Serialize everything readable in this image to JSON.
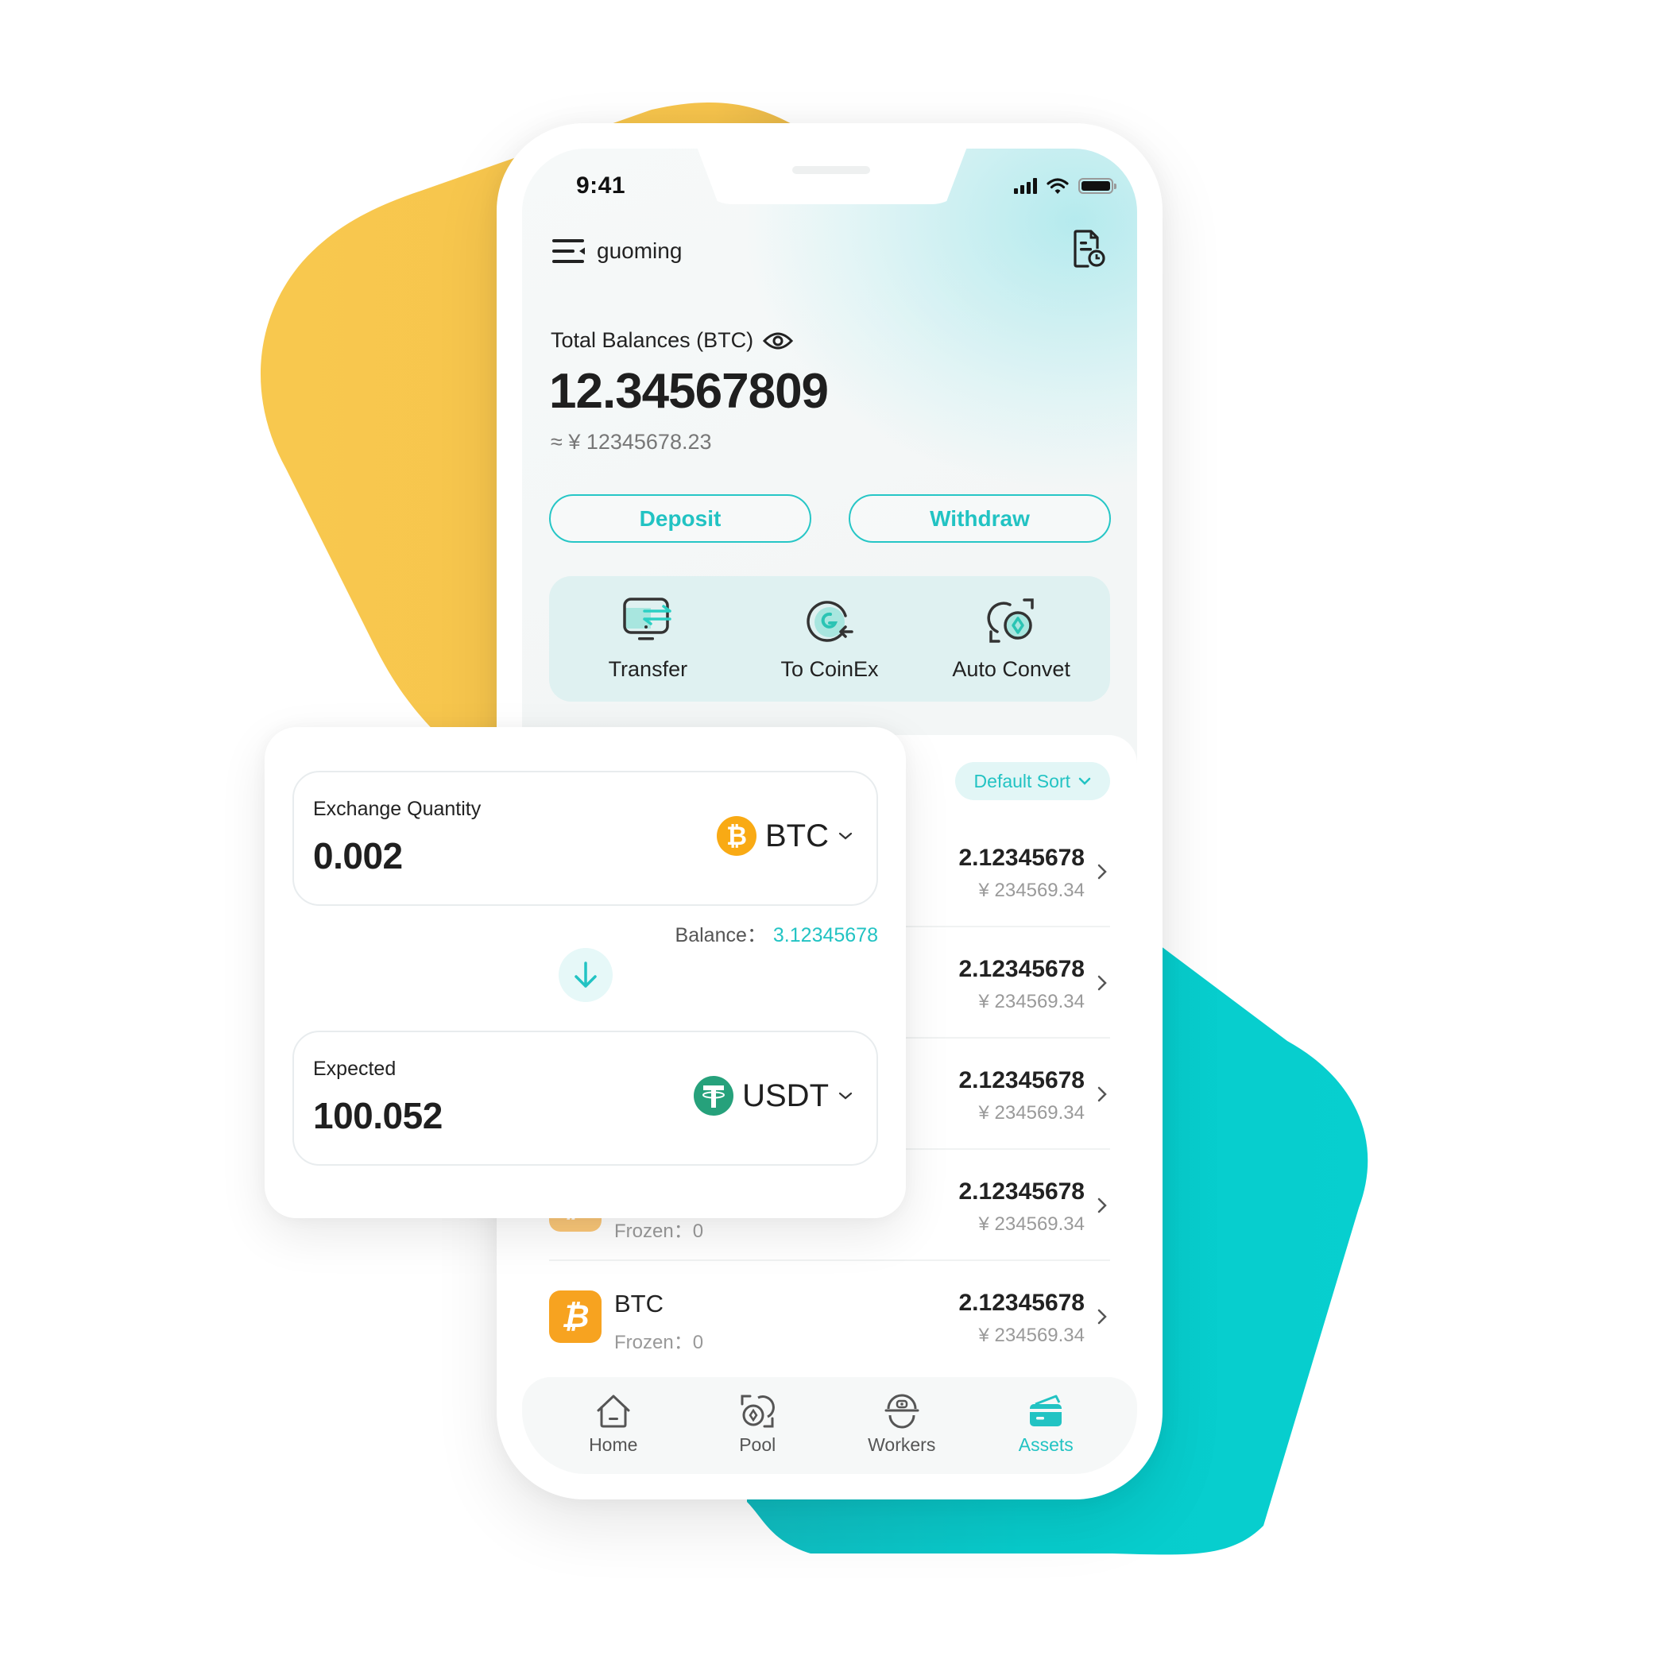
{
  "colors": {
    "accent": "#22c3c3",
    "yellow_shape": "#f7c54c",
    "teal_shape": "#07cccc",
    "btc_orange": "#f7a320",
    "usdt_green": "#26a17b"
  },
  "status_bar": {
    "time": "9:41",
    "icons": [
      "signal-icon",
      "wifi-icon",
      "battery-icon"
    ]
  },
  "header": {
    "menu_icon": "menu-icon",
    "username": "guoming",
    "record_icon": "record-icon"
  },
  "balance": {
    "label": "Total Balances (BTC)",
    "visibility_icon": "eye-icon",
    "value": "12.34567809",
    "fiat": "≈ ¥ 12345678.23"
  },
  "actions": {
    "deposit_label": "Deposit",
    "withdraw_label": "Withdraw"
  },
  "shortcuts": [
    {
      "label": "Transfer",
      "icon": "transfer-icon"
    },
    {
      "label": "To CoinEx",
      "icon": "coinex-icon"
    },
    {
      "label": "Auto Convet",
      "icon": "auto-convert-icon"
    }
  ],
  "asset_list": {
    "sort_label": "Default Sort",
    "rows": [
      {
        "name": "",
        "frozen": "",
        "amount": "2.12345678",
        "fiat": "¥ 234569.34"
      },
      {
        "name": "",
        "frozen": "",
        "amount": "2.12345678",
        "fiat": "¥ 234569.34"
      },
      {
        "name": "",
        "frozen": "",
        "amount": "2.12345678",
        "fiat": "¥ 234569.34"
      },
      {
        "name": "",
        "frozen": "Frozen：0",
        "amount": "2.12345678",
        "fiat": "¥ 234569.34"
      },
      {
        "name": "BTC",
        "frozen": "Frozen：0",
        "amount": "2.12345678",
        "fiat": "¥ 234569.34"
      }
    ]
  },
  "tabbar": {
    "tabs": [
      {
        "label": "Home",
        "icon": "home-icon",
        "active": false
      },
      {
        "label": "Pool",
        "icon": "pool-icon",
        "active": false
      },
      {
        "label": "Workers",
        "icon": "workers-icon",
        "active": false
      },
      {
        "label": "Assets",
        "icon": "assets-icon",
        "active": true
      }
    ]
  },
  "exchange": {
    "from": {
      "label": "Exchange Quantity",
      "value": "0.002",
      "coin": "BTC"
    },
    "balance_label": "Balance：",
    "balance_value": "3.12345678",
    "to": {
      "label": "Expected",
      "value": "100.052",
      "coin": "USDT"
    }
  }
}
